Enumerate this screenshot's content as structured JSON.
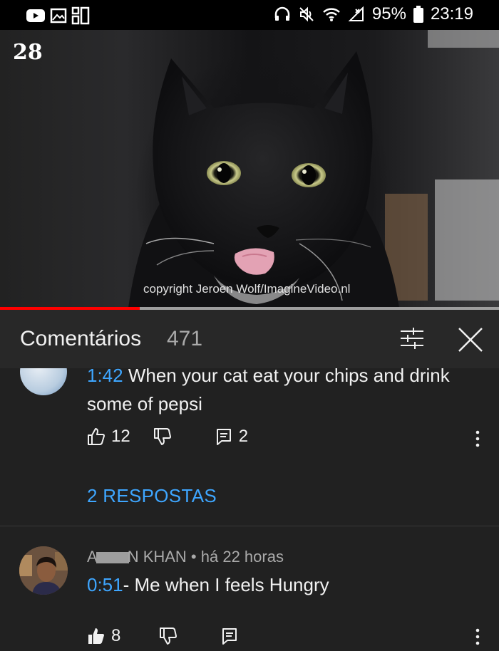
{
  "status_bar": {
    "battery_percent": "95%",
    "time": "23:19",
    "left_icons": [
      "youtube-icon",
      "gallery-icon",
      "layout-icon"
    ],
    "right_icons": [
      "headphones-icon",
      "mute-icon",
      "wifi-icon",
      "signal-icon",
      "battery-icon"
    ]
  },
  "video": {
    "counter": "28",
    "copyright": "copyright Jeroen Wolf/ImagineVideo.nl",
    "progress": 0.28,
    "progress_color": "#ff0000"
  },
  "comments": {
    "title": "Comentários",
    "count": "471",
    "items": [
      {
        "timestamp": "1:42",
        "text": " When your cat eat your chips and drink some of pepsi",
        "likes": "12",
        "replies_count": "2",
        "replies_link": "2 RESPOSTAS"
      },
      {
        "author_prefix": "A",
        "author_suffix": "N KHAN",
        "separator": " • ",
        "time_ago": "há 22 horas",
        "timestamp": "0:51",
        "text": "- Me when I feels Hungry",
        "likes": "8"
      }
    ]
  },
  "colors": {
    "link": "#3ea6ff",
    "background": "#212121",
    "header_background": "#282828"
  }
}
